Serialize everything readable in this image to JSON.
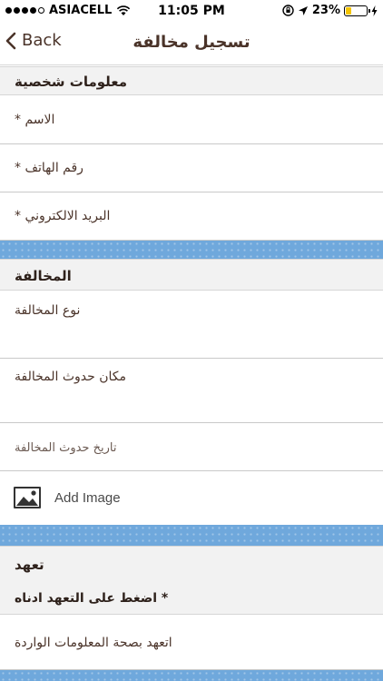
{
  "status_bar": {
    "carrier": "ASIACELL",
    "time": "11:05 PM",
    "battery": "23%",
    "battery_level": 0.23
  },
  "nav": {
    "back_label": "Back",
    "title": "تسجيل مخالفة"
  },
  "personal_section": {
    "header": "معلومات شخصية",
    "fields": [
      {
        "label": "* الاسم"
      },
      {
        "label": "* رقم الهاتف"
      },
      {
        "label": "* البريد الالكتروني"
      }
    ]
  },
  "violation_section": {
    "header": "المخالفة",
    "type_label": "نوع المخالفة",
    "place_label": "مكان حدوث المخالفة",
    "date_label": "تاريخ حدوث المخالفة",
    "add_image_label": "Add Image"
  },
  "pledge_section": {
    "header": "تعهد",
    "subheader": "* اضغط على التعهد ادناه",
    "pledge_label": "اتعهد بصحة المعلومات الواردة"
  },
  "colors": {
    "band": "#6fa8dc",
    "text": "#4a3329",
    "section_bg": "#f2f2f2"
  }
}
